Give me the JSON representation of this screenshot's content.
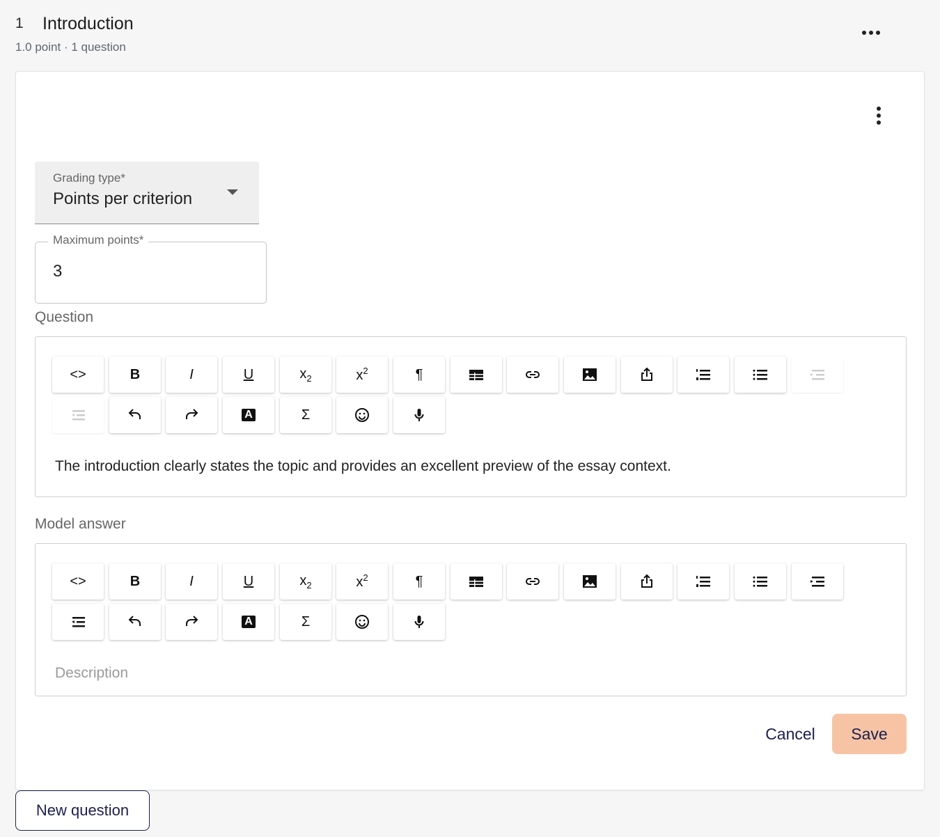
{
  "section": {
    "number": "1",
    "title": "Introduction",
    "meta": "1.0 point · 1 question",
    "more_icon": "more-horizontal-icon"
  },
  "card": {
    "more_icon": "more-vertical-icon"
  },
  "grading_type": {
    "label": "Grading type*",
    "value": "Points per criterion"
  },
  "maximum_points": {
    "label": "Maximum points*",
    "value": "3"
  },
  "question": {
    "label": "Question",
    "text": "The introduction clearly states the topic and provides an excellent preview of the essay context."
  },
  "model_answer": {
    "label": "Model answer",
    "placeholder": "Description"
  },
  "toolbar_icons": [
    "code-icon",
    "bold-icon",
    "italic-icon",
    "underline-icon",
    "subscript-icon",
    "superscript-icon",
    "paragraph-icon",
    "table-icon",
    "link-icon",
    "image-icon",
    "upload-icon",
    "ordered-list-icon",
    "bullet-list-icon",
    "indent-icon",
    "outdent-icon",
    "undo-icon",
    "redo-icon",
    "text-color-icon",
    "formula-icon",
    "emoji-icon",
    "microphone-icon"
  ],
  "toolbar_glyphs": {
    "code": "<>",
    "bold": "B",
    "italic": "I",
    "underline": "U",
    "sub_base": "x",
    "sub_index": "2",
    "sup_base": "x",
    "sup_index": "2",
    "paragraph": "¶",
    "color": "A",
    "formula": "Σ"
  },
  "actions": {
    "cancel": "Cancel",
    "save": "Save",
    "new_question": "New question"
  },
  "colors": {
    "primary": "#1a1f4e",
    "save_bg": "#f6c4a5"
  }
}
